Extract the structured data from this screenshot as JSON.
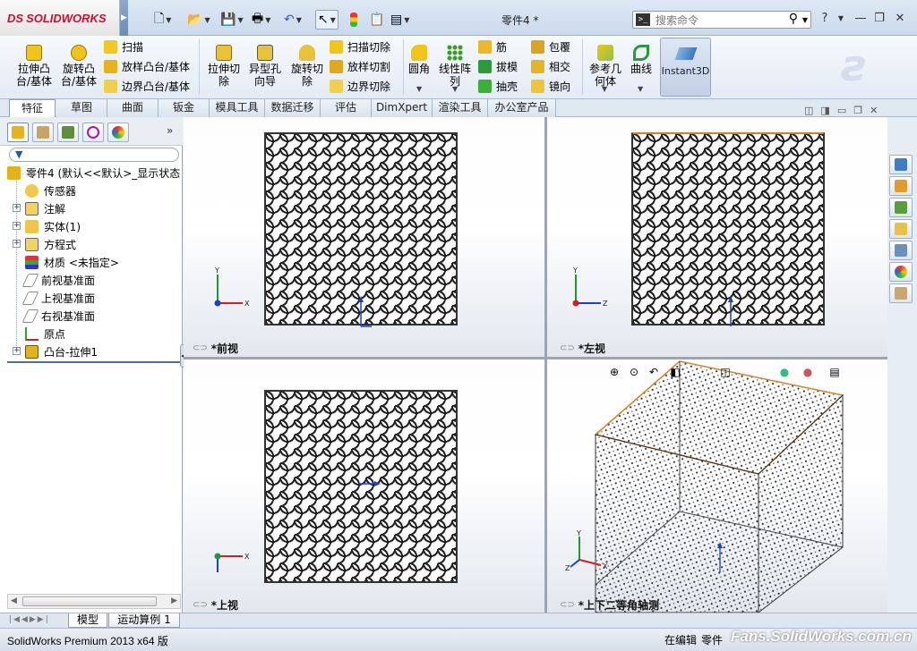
{
  "app": {
    "logo_prefix": "DS",
    "logo_name": "SOLIDWORKS",
    "document_title": "零件4 *",
    "search_placeholder": "搜索命令"
  },
  "quick_access": [
    "new-icon",
    "open-icon",
    "save-icon",
    "print-icon",
    "undo-icon",
    "select-icon",
    "rebuild-icon",
    "file-properties-icon",
    "options-icon"
  ],
  "ribbon": {
    "extruded_boss": "拉伸凸\n台/基体",
    "revolved_boss": "旋转凸\n台/基体",
    "sweep": "扫描",
    "loft": "放样凸台/基体",
    "boundary_boss": "边界凸台/基体",
    "extruded_cut": "拉伸切\n除",
    "hole_wizard": "异型孔\n向导",
    "revolved_cut": "旋转切\n除",
    "swept_cut": "扫描切除",
    "lofted_cut": "放样切割",
    "boundary_cut": "边界切除",
    "fillet": "圆角",
    "linear_pattern": "线性阵\n列",
    "rib": "筋",
    "draft": "拔模",
    "shell": "抽壳",
    "wrap": "包覆",
    "intersect": "相交",
    "mirror": "镜向",
    "ref_geometry": "参考几\n何体",
    "curves": "曲线",
    "instant3d": "Instant3D"
  },
  "tabs": [
    "特征",
    "草图",
    "曲面",
    "钣金",
    "模具工具",
    "数据迁移",
    "评估",
    "DimXpert",
    "渲染工具",
    "办公室产品"
  ],
  "tree": {
    "root": "零件4 (默认<<默认>_显示状态",
    "items": [
      "传感器",
      "注解",
      "实体(1)",
      "方程式",
      "材质 <未指定>",
      "前视基准面",
      "上视基准面",
      "右视基准面",
      "原点",
      "凸台-拉伸1"
    ]
  },
  "views": {
    "front": "*前视",
    "left": "*左视",
    "top": "*上视",
    "iso": "*上下二等角轴测"
  },
  "axes": {
    "x": "X",
    "y": "Y",
    "z": "Z"
  },
  "bottom_tabs": [
    "模型",
    "运动算例 1"
  ],
  "status": {
    "version": "SolidWorks Premium 2013 x64 版",
    "mode": "在编辑",
    "doc_type": "零件"
  },
  "watermark": "Fans.SolidWorks.com.cn",
  "colors": {
    "accent": "#c8102e",
    "selection_edge": "#d4822a",
    "axis_x": "#d32020",
    "axis_y": "#1c9a35",
    "axis_z": "#1f3fc6"
  }
}
